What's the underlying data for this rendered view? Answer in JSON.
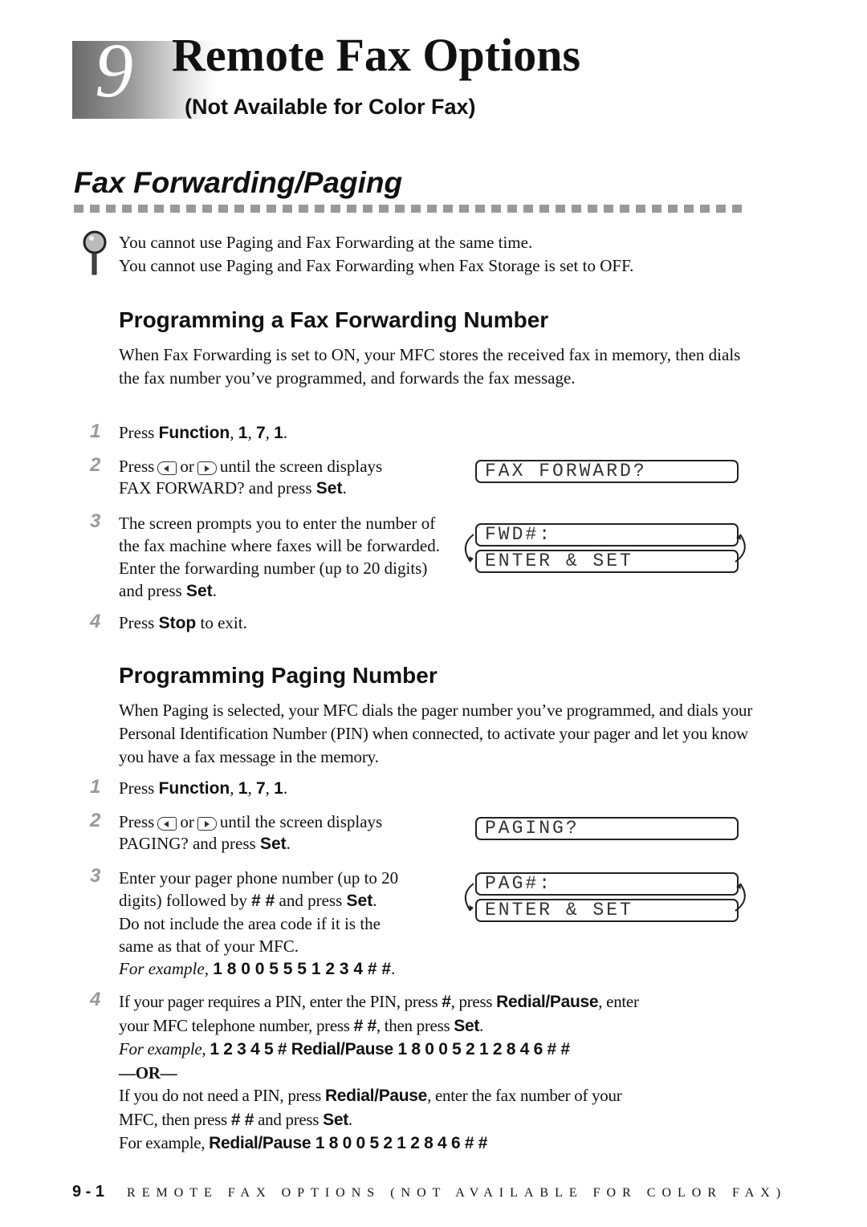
{
  "chapter": {
    "number": "9",
    "title": "Remote Fax Options",
    "subtitle": "(Not Available for Color Fax)"
  },
  "section": {
    "title": "Fax Forwarding/Paging",
    "notes": [
      "You cannot use Paging and Fax Forwarding at the same time.",
      "You cannot use Paging and Fax Forwarding when Fax Storage is set to OFF."
    ]
  },
  "forwarding": {
    "heading": "Programming a Fax Forwarding Number",
    "intro": "When Fax Forwarding is set to ON, your MFC stores the received fax in memory, then dials the fax number you’ve programmed, and forwards the fax message.",
    "steps": [
      {
        "num": "1",
        "pre": "Press ",
        "keys": "Function",
        "post": ", ",
        "k2": "1",
        "s2": ", ",
        "k3": "7",
        "s3": ", ",
        "k4": "1",
        "s4": "."
      },
      {
        "num": "2",
        "a": "Press",
        "or": "or",
        "b": "until the screen displays",
        "c": "FAX FORWARD? and press ",
        "key": "Set",
        "end": "."
      },
      {
        "num": "3",
        "text": "The screen prompts you to enter the number of the fax machine where faxes will be forwarded. Enter the forwarding number (up to 20 digits) and press ",
        "key": "Set",
        "end": "."
      },
      {
        "num": "4",
        "pre": "Press ",
        "key": "Stop",
        "post": " to exit."
      }
    ],
    "lcd": {
      "screen1": "FAX FORWARD?",
      "screen2a": "FWD#:",
      "screen2b": "ENTER & SET"
    }
  },
  "paging": {
    "heading": "Programming Paging Number",
    "intro": "When Paging is selected, your MFC dials the pager number you’ve programmed, and dials your Personal Identification Number (PIN) when connected, to activate your pager and let you know you have a fax message in the memory.",
    "steps": [
      {
        "num": "1",
        "pre": "Press ",
        "keys": "Function",
        "post": ", ",
        "k2": "1",
        "s2": ", ",
        "k3": "7",
        "s3": ", ",
        "k4": "1",
        "s4": "."
      },
      {
        "num": "2",
        "a": "Press",
        "or": "or",
        "b": "until the screen displays",
        "c": "PAGING? and press ",
        "key": "Set",
        "end": "."
      },
      {
        "num": "3",
        "l1": "Enter your pager phone number (up to 20",
        "l2a": "digits) followed by ",
        "l2k": "# #",
        "l2b": " and press ",
        "l2k2": "Set",
        "l2c": ".",
        "l3": "Do not include the area code if it is the",
        "l4": "same as that of your MFC.",
        "ex_label": "For example",
        "ex_value": "1 8 0 0 5 5 5 1 2 3 4 # #",
        "ex_end": "."
      },
      {
        "num": "4",
        "l1a": "If your pager requires a PIN, enter the PIN, press ",
        "l1k": "#",
        "l1b": ", press ",
        "l1k2": "Redial/Pause",
        "l1c": ", enter",
        "l2a": "your MFC telephone number, press ",
        "l2k": "# #",
        "l2b": ", then press ",
        "l2k2": "Set",
        "l2c": ".",
        "ex1_label": "For example",
        "ex1_value": "1 2 3 4 5 # Redial/Pause 1 8 0 0 5 2 1 2 8 4 6 # #",
        "or": "—OR—",
        "l3a": "If you do not need a PIN, press ",
        "l3k": "Redial/Pause",
        "l3b": ", enter the fax number of your",
        "l4a": "MFC, then press ",
        "l4k": "# #",
        "l4b": " and press ",
        "l4k2": "Set",
        "l4c": ".",
        "ex2_label": "For example, ",
        "ex2_value": "Redial/Pause 1 8 0 0 5 2 1 2 8 4 6 # #"
      }
    ],
    "lcd": {
      "screen1": "PAGING?",
      "screen2a": "PAG#:",
      "screen2b": "ENTER & SET"
    }
  },
  "footer": {
    "page": "9 - 1",
    "running_title": "REMOTE FAX OPTIONS (NOT AVAILABLE FOR COLOR FAX)"
  }
}
